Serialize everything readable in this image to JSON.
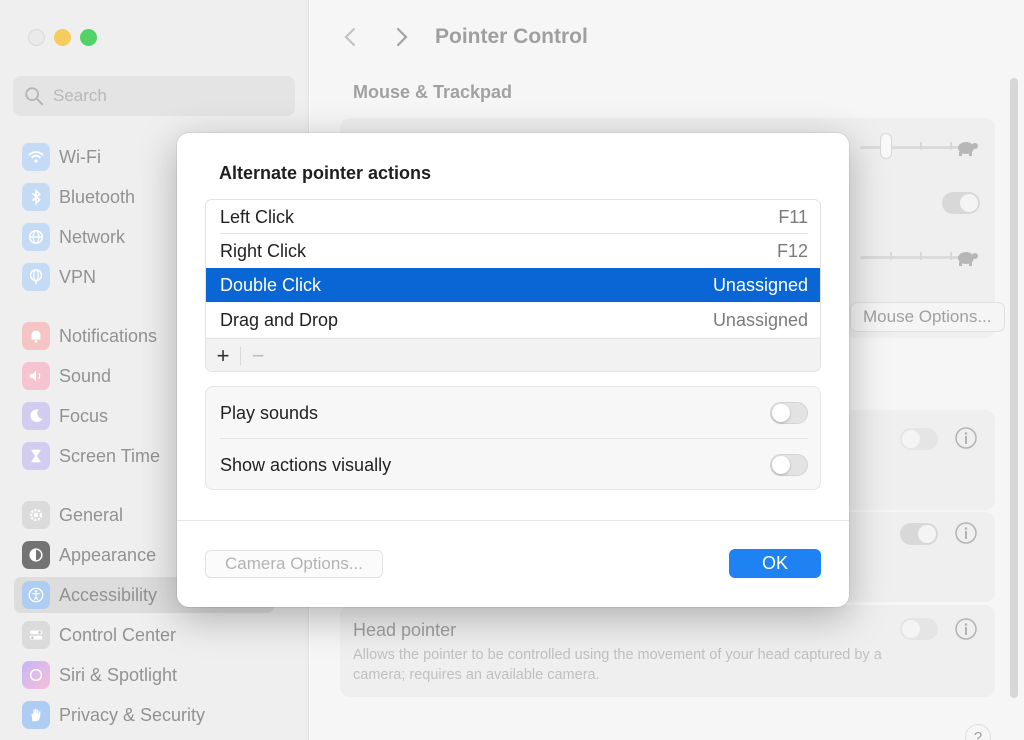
{
  "colors": {
    "accent": "#0a66d4",
    "ok_button": "#1f82f2",
    "close_light": "#e6e6e6",
    "minimize_light": "#f3c13a",
    "maximize_light": "#2dc946"
  },
  "sidebar": {
    "search_placeholder": "Search",
    "items": [
      {
        "label": "Wi-Fi",
        "icon": "wifi-icon",
        "color": "#2f8cf7"
      },
      {
        "label": "Bluetooth",
        "icon": "bluetooth-icon",
        "color": "#2f8cf7"
      },
      {
        "label": "Network",
        "icon": "globe-icon",
        "color": "#2f8cf7"
      },
      {
        "label": "VPN",
        "icon": "vpn-globe-icon",
        "color": "#2f8cf7"
      },
      {
        "label": "Notifications",
        "icon": "bell-icon",
        "color": "#f04a4a"
      },
      {
        "label": "Sound",
        "icon": "speaker-icon",
        "color": "#f0476b"
      },
      {
        "label": "Focus",
        "icon": "moon-icon",
        "color": "#6b57d6"
      },
      {
        "label": "Screen Time",
        "icon": "hourglass-icon",
        "color": "#6b57d6"
      },
      {
        "label": "General",
        "icon": "gear-icon",
        "color": "#9a9a9a"
      },
      {
        "label": "Appearance",
        "icon": "appearance-icon",
        "color": "#222222"
      },
      {
        "label": "Accessibility",
        "icon": "accessibility-icon",
        "color": "#2f8cf7"
      },
      {
        "label": "Control Center",
        "icon": "control-center-icon",
        "color": "#9a9a9a"
      },
      {
        "label": "Siri & Spotlight",
        "icon": "siri-icon",
        "color": "#7a5cff"
      },
      {
        "label": "Privacy & Security",
        "icon": "hand-icon",
        "color": "#2f8cf7"
      }
    ],
    "selected": "Accessibility"
  },
  "main": {
    "title": "Pointer Control",
    "section_title": "Mouse & Trackpad",
    "mouse_options_label": "Mouse Options...",
    "head_pointer": {
      "title": "Head pointer",
      "description": "Allows the pointer to be controlled using the movement of your head captured by a camera; requires an available camera."
    },
    "help_label": "?"
  },
  "dialog": {
    "title": "Alternate pointer actions",
    "actions": [
      {
        "name": "Left Click",
        "key": "F11"
      },
      {
        "name": "Right Click",
        "key": "F12"
      },
      {
        "name": "Double Click",
        "key": "Unassigned"
      },
      {
        "name": "Drag and Drop",
        "key": "Unassigned"
      }
    ],
    "selected_action": "Double Click",
    "add_label": "+",
    "remove_label": "−",
    "options": [
      {
        "label": "Play sounds",
        "on": false
      },
      {
        "label": "Show actions visually",
        "on": false
      }
    ],
    "camera_options_label": "Camera Options...",
    "ok_label": "OK"
  }
}
